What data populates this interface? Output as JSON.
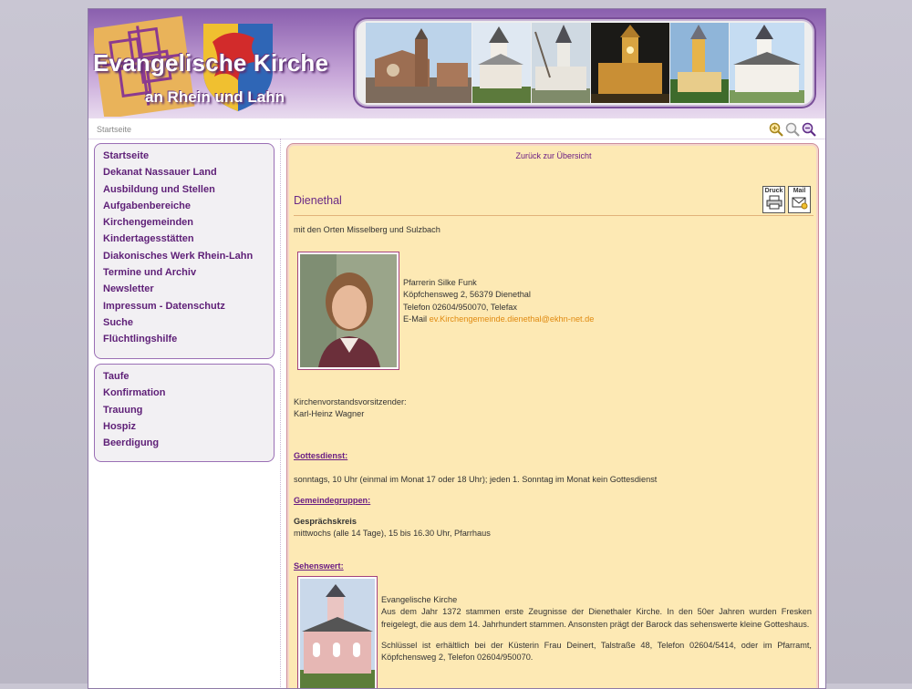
{
  "header": {
    "title": "Evangelische Kirche",
    "subtitle": "an Rhein und Lahn"
  },
  "breadcrumb": "Startseite",
  "zoom": {
    "in_icon": "zoom-in-icon",
    "reset_icon": "zoom-reset-icon",
    "out_icon": "zoom-out-icon"
  },
  "nav_main": [
    "Startseite",
    "Dekanat Nassauer Land",
    "Ausbildung und Stellen",
    "Aufgabenbereiche",
    "Kirchengemeinden",
    "Kindertagesstätten",
    "Diakonisches Werk Rhein-Lahn",
    "Termine und Archiv",
    "Newsletter",
    "Impressum - Datenschutz",
    "Suche",
    "Flüchtlingshilfe"
  ],
  "nav_life": [
    "Taufe",
    "Konfirmation",
    "Trauung",
    "Hospiz",
    "Beerdigung"
  ],
  "content": {
    "back_link": "Zurück zur Übersicht",
    "heading": "Dienethal",
    "print_label": "Druck",
    "mail_label": "Mail",
    "intro": "mit den Orten Misselberg und Sulzbach",
    "pastor": {
      "name": "Pfarrerin Silke Funk",
      "address": "Köpfchensweg 2, 56379 Dienethal",
      "phone": "Telefon 02604/950070, Telefax",
      "email_label": "E-Mail",
      "email": "ev.Kirchengemeinde.dienethal@ekhn-net.de"
    },
    "council_label": "Kirchenvorstandsvorsitzender:",
    "council_name": "Karl-Heinz Wagner",
    "service_heading": "Gottesdienst:",
    "service_text": "sonntags, 10 Uhr (einmal im Monat 17 oder 18 Uhr); jeden 1. Sonntag im Monat kein Gottesdienst",
    "groups_heading": "Gemeindegruppen:",
    "group_name": "Gesprächskreis",
    "group_text": "mittwochs (alle 14 Tage), 15 bis 16.30 Uhr, Pfarrhaus",
    "sights_heading": "Sehenswert:",
    "church_title": "Evangelische Kirche",
    "church_text": "Aus dem Jahr 1372 stammen erste Zeugnisse der Dienethaler Kirche. In den 50er Jahren wurden Fresken freigelegt, die aus dem 14. Jahrhundert stammen. Ansonsten prägt der Barock das sehenswerte kleine Gotteshaus.",
    "key_text": "Schlüssel ist erhältlich bei der Küsterin Frau Deinert, Talstraße 48, Telefon 02604/5414, oder im Pfarramt, Köpfchensweg 2, Telefon 02604/950070."
  }
}
